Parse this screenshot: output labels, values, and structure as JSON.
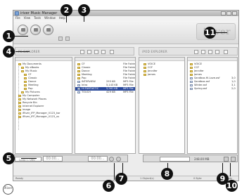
{
  "window": {
    "title": "iriver Music Manager",
    "menu": [
      "File",
      "View",
      "Tools",
      "Window",
      "Help"
    ]
  },
  "logo_text": "iriver",
  "left_path_label": "PC EXPLORER",
  "right_path_label": "iPOD EXPLORER",
  "tree": [
    "My Documents",
    "My eBooks",
    "My Music",
    "CF",
    "Classic",
    "Dance",
    "Meeting",
    "Pop",
    "My Pictures",
    "My Computer",
    "My Network Places",
    "Recycle Bin",
    "Internet Explorer",
    "image",
    "iRiver_IFP_Manager_V123_kor",
    "iRiver_IFP_Manager_V123_us"
  ],
  "left_files": [
    {
      "name": "CF",
      "size": "",
      "type": "File Folder"
    },
    {
      "name": "Classic",
      "size": "",
      "type": "File Folder"
    },
    {
      "name": "Dance",
      "size": "",
      "type": "File Folder"
    },
    {
      "name": "Meeting",
      "size": "",
      "type": "File Folder"
    },
    {
      "name": "Pop",
      "size": "",
      "type": "File Folder"
    },
    {
      "name": "INTERVIEW",
      "size": "293 KB",
      "type": "MP3 File"
    },
    {
      "name": "Intro",
      "size": "5,143 KB",
      "type": "MP3 File"
    },
    {
      "name": "HI FANTASTIC",
      "size": "5,561 KB",
      "type": "MP3 File"
    },
    {
      "name": "TOUCH",
      "size": "429 KB",
      "type": "MP3 File"
    }
  ],
  "device_tree": [
    "VOICE",
    "CCF",
    "Jennifer",
    "James"
  ],
  "device_files": [
    {
      "name": "VOICE",
      "size": ""
    },
    {
      "name": "CCF",
      "size": ""
    },
    {
      "name": "Jennifer",
      "size": ""
    },
    {
      "name": "James",
      "size": ""
    },
    {
      "name": "Sandbox.Hi.Love.asf",
      "size": "3,0"
    },
    {
      "name": "Sandbox.asf",
      "size": "1,0"
    },
    {
      "name": "Winter.asf",
      "size": "3,1"
    },
    {
      "name": "Spring.asf",
      "size": "2,0"
    }
  ],
  "transport": {
    "seek_label": "Loop  ▷  000",
    "time": "00:00..."
  },
  "device_status": {
    "capacity": "248.00 MB"
  },
  "status_left": "Ready",
  "status_mid": "1 Object(s)",
  "status_right": "0 Byte",
  "status_right2": "Ready",
  "callouts": [
    "1",
    "2",
    "3",
    "4",
    "5",
    "6",
    "7",
    "8",
    "9",
    "10",
    "11"
  ],
  "brand_mark": "iRiver"
}
